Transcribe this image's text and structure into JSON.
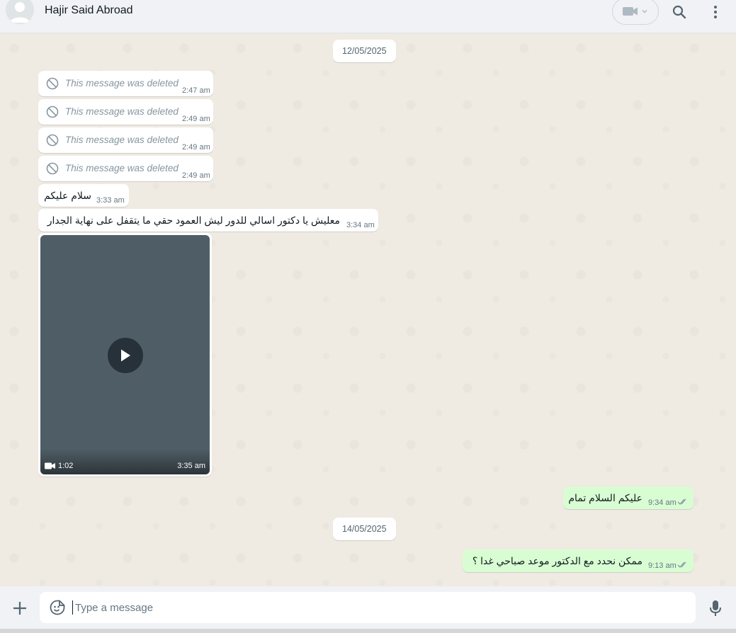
{
  "header": {
    "contact_name": "Hajir Said Abroad",
    "icons": [
      "avatar",
      "video-call-icon",
      "chevron-down-icon",
      "search-icon",
      "menu-icon"
    ]
  },
  "dates": [
    "12/05/2025",
    "14/05/2025"
  ],
  "messages": {
    "deleted_text": "This message was deleted",
    "deleted": [
      {
        "time": "2:47 am"
      },
      {
        "time": "2:49 am"
      },
      {
        "time": "2:49 am"
      },
      {
        "time": "2:49 am"
      }
    ],
    "in_text_1": {
      "text": "سلام عليكم",
      "time": "3:33 am"
    },
    "in_text_2": {
      "text": "معليش يا دكتور اسالي للدور ليش العمود حقي ما يتقفل على نهاية الجدار",
      "time": "3:34 am"
    },
    "video": {
      "duration": "1:02",
      "time": "3:35 am"
    },
    "out_1": {
      "text": "عليكم السلام تمام",
      "time": "9:34 am"
    },
    "out_2": {
      "text": "ممكن نحدد مع الدكتور موعد صباحي غدا ؟",
      "time": "9:13 am"
    }
  },
  "composer": {
    "placeholder": "Type a message"
  },
  "colors": {
    "chat_bg": "#efeae2",
    "outgoing_bubble": "#d9fdd3",
    "incoming_bubble": "#ffffff",
    "header_bg": "#f0f2f5"
  }
}
